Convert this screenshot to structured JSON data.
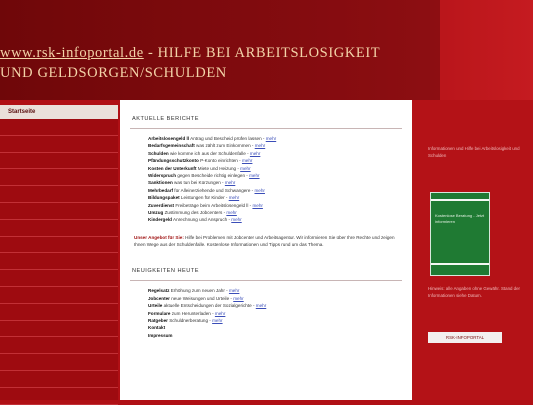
{
  "header": {
    "site_name": "www.rsk-infoportal.de",
    "title_rest": " - HILFE BEI ARBEITSLOSIGKEIT",
    "title_line2": "UND GELDSORGEN/SCHULDEN"
  },
  "nav": {
    "header": "Startseite",
    "items": [
      "",
      "",
      "",
      "",
      "",
      "",
      "",
      "",
      "",
      "",
      "",
      "",
      "",
      "",
      "",
      "",
      ""
    ]
  },
  "content": {
    "section1_title": "AKTUELLE BERICHTE",
    "section1_items": [
      {
        "bold": "Arbeitslosengeld ll",
        "text": " Antrag und Bescheid prüfen lassen - ",
        "link": "mehr"
      },
      {
        "bold": "Bedarfsgemeinschaft",
        "text": " was zählt zum Einkommen - ",
        "link": "mehr"
      },
      {
        "bold": "Schulden",
        "text": " wie komme ich aus der Schuldenfalle - ",
        "link": "mehr"
      },
      {
        "bold": "Pfändungsschutzkonto",
        "text": " P-Konto einrichten - ",
        "link": "mehr"
      },
      {
        "bold": "Kosten der Unterkunft",
        "text": " Miete und Heizung - ",
        "link": "mehr"
      },
      {
        "bold": "Widerspruch",
        "text": " gegen Bescheide richtig einlegen - ",
        "link": "mehr"
      },
      {
        "bold": "Sanktionen",
        "text": " was tun bei Kürzungen - ",
        "link": "mehr"
      },
      {
        "bold": "Mehrbedarf",
        "text": " für Alleinerziehende und Schwangere - ",
        "link": "mehr"
      },
      {
        "bold": "Bildungspaket",
        "text": " Leistungen für Kinder - ",
        "link": "mehr"
      },
      {
        "bold": "Zuverdienst",
        "text": " Freibeträge beim Arbeitslosengeld ll - ",
        "link": "mehr"
      },
      {
        "bold": "Umzug",
        "text": " Zustimmung des Jobcenters - ",
        "link": "mehr"
      },
      {
        "bold": "Kindergeld",
        "text": " Anrechnung und Anspruch - ",
        "link": "mehr"
      }
    ],
    "paragraph_bold": "Unser Angebot für Sie:",
    "paragraph": " Hilfe bei Problemen mit Jobcenter und Arbeitsagentur. Wir informieren Sie über Ihre Rechte und zeigen Ihnen Wege aus der Schuldenfalle. Kostenlose Informationen und Tipps rund um das Thema.",
    "section2_title": "NEUIGKEITEN HEUTE",
    "section2_items": [
      {
        "bold": "Regelsatz",
        "text": " Erhöhung zum neuen Jahr - ",
        "link": "mehr"
      },
      {
        "bold": "Jobcenter",
        "text": " neue Weisungen und Urteile - ",
        "link": "mehr"
      },
      {
        "bold": "Urteile",
        "text": " aktuelle Entscheidungen der Sozialgerichte - ",
        "link": "mehr"
      },
      {
        "bold": "Formulare",
        "text": " zum Herunterladen - ",
        "link": "mehr"
      },
      {
        "bold": "Ratgeber",
        "text": " Schuldnerberatung - ",
        "link": "mehr"
      },
      {
        "bold": "Kontakt",
        "text": "",
        "link": ""
      },
      {
        "bold": "Impressum",
        "text": "",
        "link": ""
      }
    ]
  },
  "right": {
    "text_top": "Informationen und Hilfe bei Arbeitslosigkeit und Schulden",
    "green_text": "Kostenlose Beratung - Jetzt informieren",
    "text_bottom": "Hinweis: alle Angaben ohne Gewähr. Stand der Informationen siehe Datum.",
    "badge": "RSK-INFOPORTAL"
  },
  "colors": {
    "brand": "#b01015",
    "header_text": "#f3d3a8",
    "link": "#3a4db8"
  }
}
